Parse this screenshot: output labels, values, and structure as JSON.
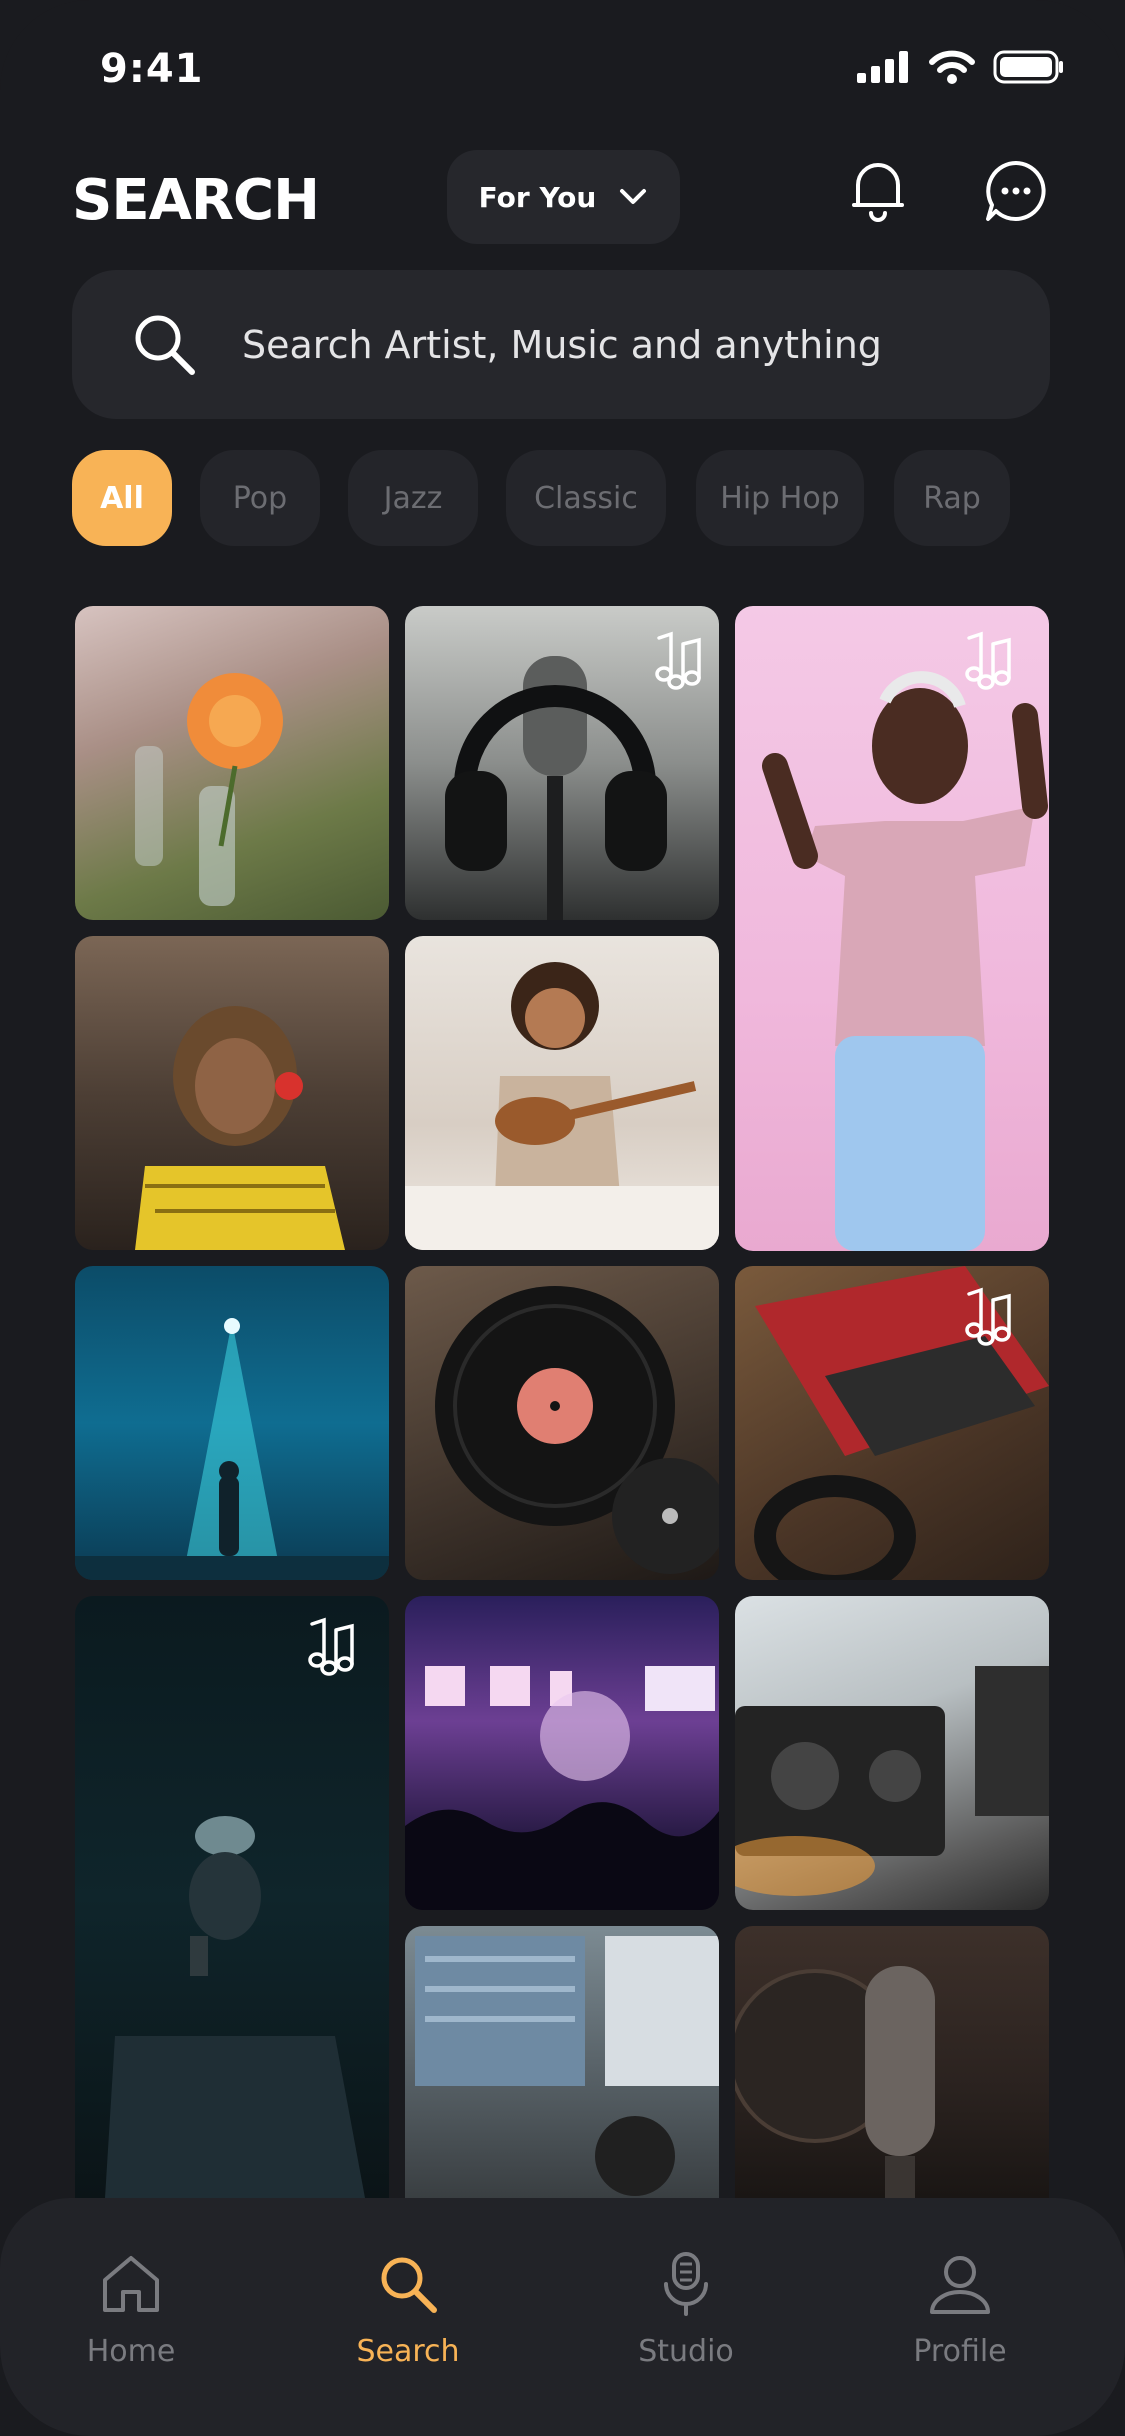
{
  "status": {
    "time": "9:41"
  },
  "header": {
    "title": "SEARCH",
    "feed_selector": "For You"
  },
  "search": {
    "placeholder": "Search Artist, Music and anything"
  },
  "filters": [
    "All",
    "Pop",
    "Jazz",
    "Classic",
    "Hip Hop",
    "Rap"
  ],
  "active_filter": "All",
  "colors": {
    "accent": "#f8b356",
    "background": "#1a1b1f",
    "surface": "#26272c",
    "muted_text": "#6c6d72"
  },
  "tiles": [
    {
      "name": "tile-flowers-table",
      "music_badge": false
    },
    {
      "name": "tile-headphones-mic",
      "music_badge": true
    },
    {
      "name": "tile-dancing-woman",
      "music_badge": true
    },
    {
      "name": "tile-woman-red-headphones",
      "music_badge": false
    },
    {
      "name": "tile-girl-ukulele",
      "music_badge": false
    },
    {
      "name": "tile-spotlight-stage",
      "music_badge": false
    },
    {
      "name": "tile-vinyl-record",
      "music_badge": false
    },
    {
      "name": "tile-drum-pad",
      "music_badge": true
    },
    {
      "name": "tile-singer-dark",
      "music_badge": true
    },
    {
      "name": "tile-concert-crowd",
      "music_badge": false
    },
    {
      "name": "tile-dj-controller",
      "music_badge": false
    },
    {
      "name": "tile-studio-monitors",
      "music_badge": false
    },
    {
      "name": "tile-condenser-mic",
      "music_badge": false
    }
  ],
  "nav": {
    "items": [
      {
        "label": "Home",
        "icon": "home-icon"
      },
      {
        "label": "Search",
        "icon": "search-icon"
      },
      {
        "label": "Studio",
        "icon": "microphone-icon"
      },
      {
        "label": "Profile",
        "icon": "user-icon"
      }
    ],
    "active": "Search"
  }
}
